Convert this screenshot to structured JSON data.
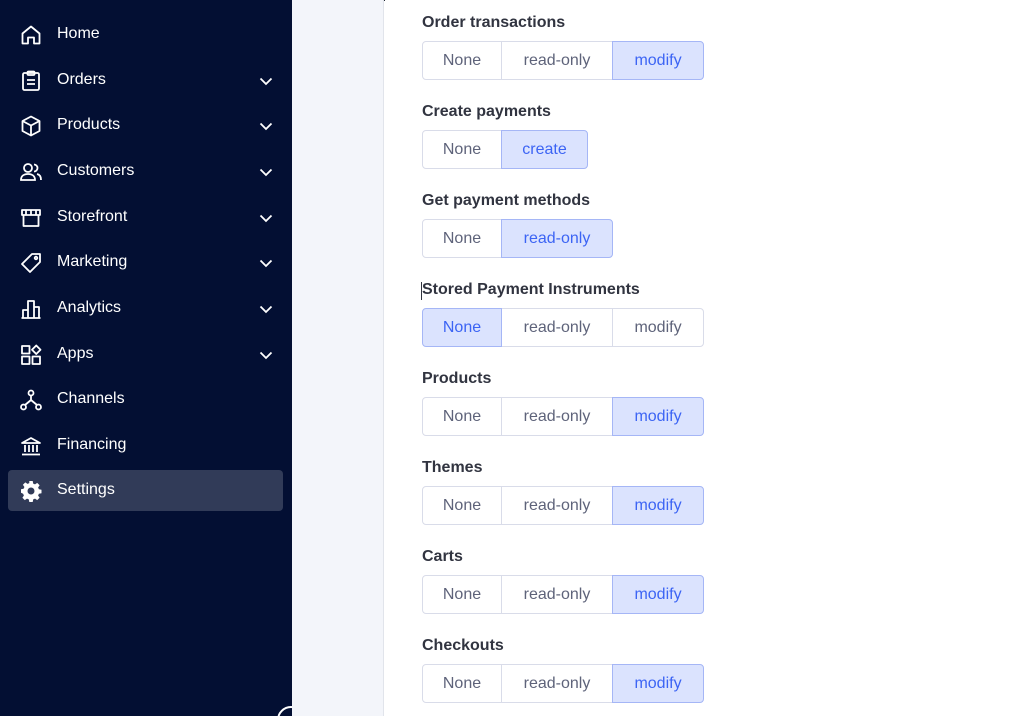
{
  "sidebar": {
    "items": [
      {
        "label": "Home",
        "icon": "home-icon",
        "has_chevron": false,
        "active": false
      },
      {
        "label": "Orders",
        "icon": "orders-icon",
        "has_chevron": true,
        "active": false
      },
      {
        "label": "Products",
        "icon": "box-icon",
        "has_chevron": true,
        "active": false
      },
      {
        "label": "Customers",
        "icon": "customers-icon",
        "has_chevron": true,
        "active": false
      },
      {
        "label": "Storefront",
        "icon": "storefront-icon",
        "has_chevron": true,
        "active": false
      },
      {
        "label": "Marketing",
        "icon": "tag-icon",
        "has_chevron": true,
        "active": false
      },
      {
        "label": "Analytics",
        "icon": "bar-chart-icon",
        "has_chevron": true,
        "active": false
      },
      {
        "label": "Apps",
        "icon": "apps-icon",
        "has_chevron": true,
        "active": false
      },
      {
        "label": "Channels",
        "icon": "channels-icon",
        "has_chevron": false,
        "active": false
      },
      {
        "label": "Financing",
        "icon": "bank-icon",
        "has_chevron": false,
        "active": false
      },
      {
        "label": "Settings",
        "icon": "gear-icon",
        "has_chevron": false,
        "active": true
      }
    ]
  },
  "permissions": [
    {
      "title": "Order transactions",
      "options": [
        "None",
        "read-only",
        "modify"
      ],
      "selected": "modify"
    },
    {
      "title": "Create payments",
      "options": [
        "None",
        "create"
      ],
      "selected": "create"
    },
    {
      "title": "Get payment methods",
      "options": [
        "None",
        "read-only"
      ],
      "selected": "read-only"
    },
    {
      "title": "Stored Payment Instruments",
      "options": [
        "None",
        "read-only",
        "modify"
      ],
      "selected": "None"
    },
    {
      "title": "Products",
      "options": [
        "None",
        "read-only",
        "modify"
      ],
      "selected": "modify"
    },
    {
      "title": "Themes",
      "options": [
        "None",
        "read-only",
        "modify"
      ],
      "selected": "modify"
    },
    {
      "title": "Carts",
      "options": [
        "None",
        "read-only",
        "modify"
      ],
      "selected": "modify"
    },
    {
      "title": "Checkouts",
      "options": [
        "None",
        "read-only",
        "modify"
      ],
      "selected": "modify"
    }
  ],
  "colors": {
    "sidebar_bg": "#030f33",
    "sidebar_active": "#313b58",
    "selected_bg": "#dbe3fe",
    "selected_text": "#3c64f4"
  }
}
